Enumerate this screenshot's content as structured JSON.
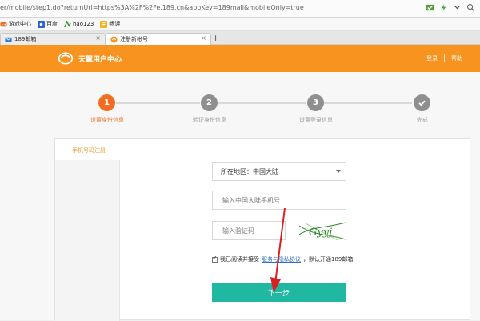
{
  "browser": {
    "address": "er/mobile/step1.do?returnUrl=https%3A%2F%2Fe.189.cn&appKey=189mail&mobileOnly=true",
    "favorites": [
      {
        "label": "游戏中心",
        "icon": "gamepad-icon"
      },
      {
        "label": "百度",
        "icon": "baidu-icon"
      },
      {
        "label": "hao123",
        "icon": "hao123-icon"
      },
      {
        "label": "畅读",
        "icon": "reader-icon"
      }
    ],
    "tabs": [
      {
        "label": "189邮箱",
        "icon": "mail-icon",
        "active": false
      },
      {
        "label": "注册新帐号",
        "icon": "tianyi-icon",
        "active": true
      }
    ],
    "add_tab": "+"
  },
  "header": {
    "logo_text": "天翼用户中心",
    "login": "登录",
    "help": "帮助",
    "brand_color": "#f7931e"
  },
  "steps": [
    {
      "number": "1",
      "label": "设置身份信息",
      "active": true
    },
    {
      "number": "2",
      "label": "验证身份信息",
      "active": false
    },
    {
      "number": "3",
      "label": "设置登录信息",
      "active": false
    },
    {
      "number": "check-icon",
      "label": "完成",
      "active": false
    }
  ],
  "form": {
    "tab_label": "手机号码注册",
    "region": "所在地区：中国大陆",
    "phone_placeholder": "输入中国大陆手机号",
    "captcha_placeholder": "输入验证码",
    "captcha_text": "Gyyj",
    "agree_prefix": "我已阅读并接受",
    "agreement_link": "服务与隐私协议",
    "agree_suffix": "，默认开通189邮箱",
    "next_button": "下一步",
    "button_color": "#20b8a0"
  }
}
